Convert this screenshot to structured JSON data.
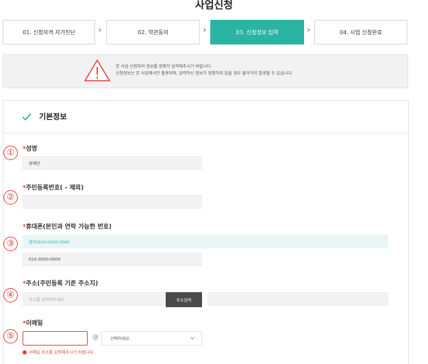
{
  "page": {
    "title": "사업신청"
  },
  "steps": [
    {
      "label": "01. 신청자격 자가진단",
      "active": false
    },
    {
      "label": "02. 약관동의",
      "active": false
    },
    {
      "label": "03. 신청정보 입력",
      "active": true
    },
    {
      "label": "04. 사업 신청완료",
      "active": false
    }
  ],
  "notice": {
    "line1": "본 사업 신청자의 정보를 정확히 입력해주시기 바랍니다.",
    "line2": "신청정보는 본 사업에서만 활용되며, 입력하신 정보가 정확하지 않을 경우 불이익이 발생할 수 있습니다."
  },
  "section": {
    "title": "기본정보"
  },
  "markers": [
    "①",
    "②",
    "③",
    "④",
    "⑤"
  ],
  "required_mark": "*",
  "fields": {
    "name": {
      "label": "성명",
      "value": "광재단"
    },
    "rrn": {
      "label": "주민등록번호( - 제외)",
      "value": ""
    },
    "phone": {
      "label": "휴대폰(본인과 연락 가능한 번호)",
      "hint": "형식)010-0000-0000",
      "value": "010-0000-0000"
    },
    "address": {
      "label": "주소(주민등록 기준 주소지)",
      "placeholder": "주소를 입력해주세요",
      "button": "주소입력",
      "detail": ""
    },
    "email": {
      "label": "이메일",
      "value": "",
      "at": "@",
      "domain_select": "선택하세요.",
      "error": "이메일 주소를 입력해주시기 바랍니다."
    }
  },
  "colors": {
    "accent": "#2bb3a3",
    "error": "#e53935",
    "dark_button": "#4a4a4a"
  },
  "icons": {
    "notice": "warning-triangle-icon",
    "section": "check-icon",
    "select": "chevron-down-icon",
    "error": "error-dot-icon"
  }
}
